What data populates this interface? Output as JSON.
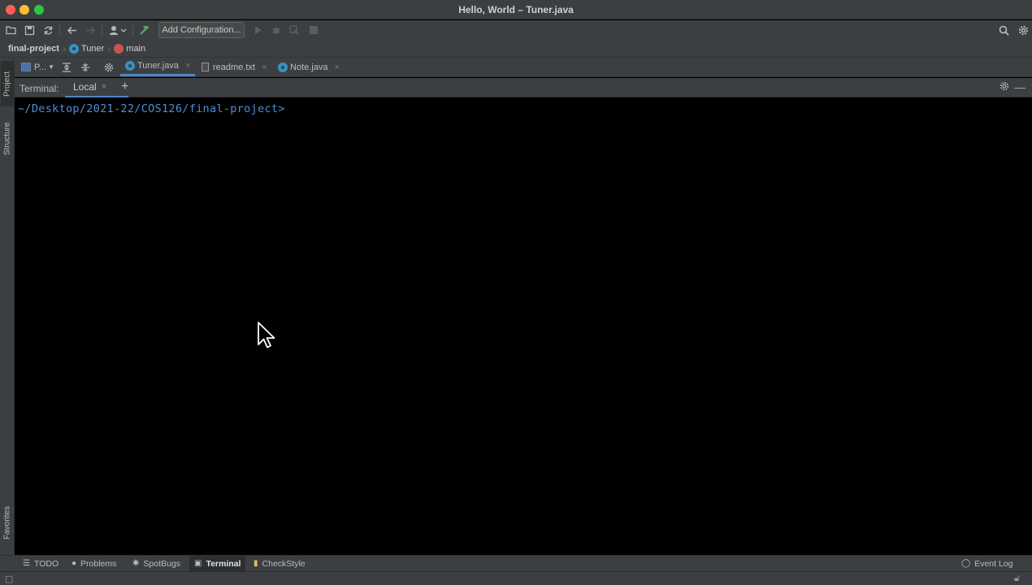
{
  "window": {
    "title": "Hello, World – Tuner.java"
  },
  "toolbar": {
    "add_configuration": "Add Configuration..."
  },
  "navbar": {
    "project": "final-project",
    "class": "Tuner",
    "method": "main"
  },
  "left_strip": {
    "project": "Project",
    "structure": "Structure",
    "favorites": "Favorites"
  },
  "project_tool": {
    "label": "P..."
  },
  "editor_tabs": [
    {
      "label": "Tuner.java",
      "active": true,
      "icon": "java-class-icon"
    },
    {
      "label": "readme.txt",
      "active": false,
      "icon": "text-file-icon"
    },
    {
      "label": "Note.java",
      "active": false,
      "icon": "java-class-icon"
    }
  ],
  "terminal": {
    "label": "Terminal:",
    "tab": "Local",
    "prompt": "~/Desktop/2021-22/COS126/final-project>"
  },
  "bottom_tools": [
    {
      "label": "TODO",
      "icon": "list-icon"
    },
    {
      "label": "Problems",
      "icon": "info-icon"
    },
    {
      "label": "SpotBugs",
      "icon": "bug-icon"
    },
    {
      "label": "Terminal",
      "icon": "terminal-icon",
      "active": true
    },
    {
      "label": "CheckStyle",
      "icon": "checkstyle-icon"
    }
  ],
  "event_log": {
    "label": "Event Log"
  },
  "colors": {
    "accent": "#4a88c7",
    "prompt": "#4f8fd6",
    "chrome": "#3c3f41"
  }
}
